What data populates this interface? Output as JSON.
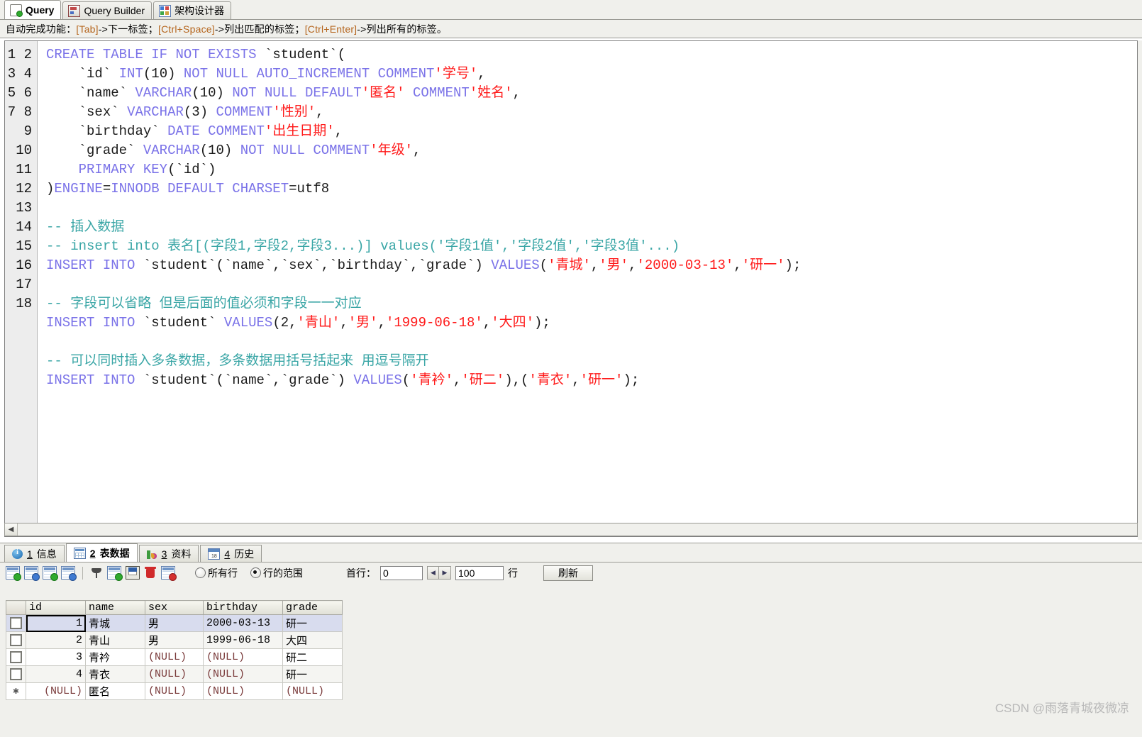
{
  "top_tabs": [
    {
      "label": "Query",
      "icon": "query-icon",
      "active": true
    },
    {
      "label": "Query Builder",
      "icon": "query-builder-icon",
      "active": false
    },
    {
      "label": "架构设计器",
      "icon": "schema-designer-icon",
      "active": false
    }
  ],
  "hint_bar": {
    "prefix": "自动完成功能：",
    "seg1_key": "[Tab]",
    "seg1_text": "->下一标签；",
    "seg2_key": "[Ctrl+Space]",
    "seg2_text": "->列出匹配的标签；",
    "seg3_key": "[Ctrl+Enter]",
    "seg3_text": "->列出所有的标签。"
  },
  "editor": {
    "line_numbers": [
      "1",
      "2",
      "3",
      "4",
      "5",
      "6",
      "7",
      "8",
      "9",
      "10",
      "11",
      "12",
      "13",
      "14",
      "15",
      "16",
      "17",
      "18"
    ],
    "lines": [
      "CREATE TABLE IF NOT EXISTS `student`(",
      "    `id` INT(10) NOT NULL AUTO_INCREMENT COMMENT'学号',",
      "    `name` VARCHAR(10) NOT NULL DEFAULT'匿名' COMMENT'姓名',",
      "    `sex` VARCHAR(3) COMMENT'性别',",
      "    `birthday` DATE COMMENT'出生日期',",
      "    `grade` VARCHAR(10) NOT NULL COMMENT'年级',",
      "    PRIMARY KEY(`id`)",
      ")ENGINE=INNODB DEFAULT CHARSET=utf8",
      "",
      "-- 插入数据",
      "-- insert into 表名[(字段1,字段2,字段3...)] values('字段1值','字段2值','字段3值'...)",
      "INSERT INTO `student`(`name`,`sex`,`birthday`,`grade`) VALUES('青城','男','2000-03-13','研一');",
      "",
      "-- 字段可以省略 但是后面的值必须和字段一一对应",
      "INSERT INTO `student` VALUES(2,'青山','男','1999-06-18','大四');",
      "",
      "-- 可以同时插入多条数据，多条数据用括号括起来 用逗号隔开",
      "INSERT INTO `student`(`name`,`grade`) VALUES('青衿','研二'),('青衣','研一');"
    ]
  },
  "bottom_tabs": [
    {
      "num": "1",
      "label": "信息",
      "icon": "info-icon",
      "active": false
    },
    {
      "num": "2",
      "label": "表数据",
      "icon": "table-data-icon",
      "active": true
    },
    {
      "num": "3",
      "label": "资料",
      "icon": "chart-icon",
      "active": false
    },
    {
      "num": "4",
      "label": "历史",
      "icon": "calendar-icon",
      "active": false
    }
  ],
  "grid_toolbar": {
    "icons": [
      "insert-row-icon",
      "duplicate-row-icon",
      "export-grid-icon",
      "refresh-grid-icon",
      "filter-icon",
      "grid-view-icon",
      "save-icon",
      "delete-icon",
      "cancel-icon"
    ],
    "radio_all_rows": "所有行",
    "radio_row_range": "行的范围",
    "selected_radio": "行的范围",
    "first_row_label": "首行：",
    "first_row_value": "0",
    "count_value": "100",
    "count_unit": "行",
    "refresh_label": "刷新"
  },
  "data_grid": {
    "columns": [
      "id",
      "name",
      "sex",
      "birthday",
      "grade"
    ],
    "rows": [
      {
        "id": "1",
        "name": "青城",
        "sex": "男",
        "birthday": "2000-03-13",
        "grade": "研一"
      },
      {
        "id": "2",
        "name": "青山",
        "sex": "男",
        "birthday": "1999-06-18",
        "grade": "大四"
      },
      {
        "id": "3",
        "name": "青衿",
        "sex": "(NULL)",
        "birthday": "(NULL)",
        "grade": "研二"
      },
      {
        "id": "4",
        "name": "青衣",
        "sex": "(NULL)",
        "birthday": "(NULL)",
        "grade": "研一"
      },
      {
        "id": "(NULL)",
        "name": "匿名",
        "sex": "(NULL)",
        "birthday": "(NULL)",
        "grade": "(NULL)"
      }
    ]
  },
  "watermark": "CSDN @雨落青城夜微凉",
  "colors": {
    "keyword": "#7a72e8",
    "string": "#ff1a1a",
    "comment": "#3aa6a6",
    "id_header": "#f3cf84",
    "selected_row": "#d8dcee"
  }
}
